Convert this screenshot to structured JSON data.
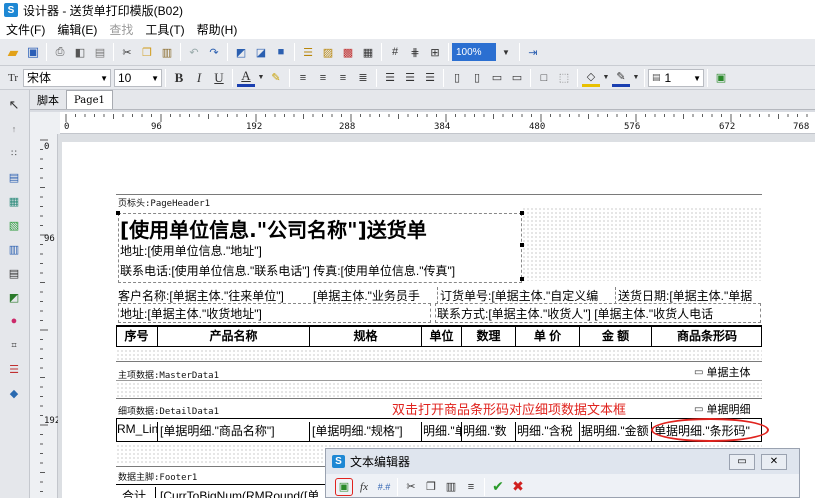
{
  "window": {
    "title": "设计器 - 送货单打印模版(B02)"
  },
  "menu": [
    "文件(F)",
    "编辑(E)",
    "查找",
    "工具(T)",
    "帮助(H)"
  ],
  "toolbar2": {
    "font": "宋体",
    "size": "10",
    "line_width": "1",
    "bold": "B",
    "italic": "I",
    "underline": "U",
    "font_color": "A",
    "zoom": "100%"
  },
  "tabs": [
    "脚本",
    "Page1"
  ],
  "ruler": {
    "marks": [
      "0",
      "96",
      "192",
      "288",
      "384",
      "480",
      "576",
      "672",
      "768"
    ],
    "vmarks": [
      "0",
      "96",
      "192"
    ]
  },
  "report": {
    "page_header_label": "页标头:PageHeader1",
    "title": "[使用单位信息.\"公司名称\"]送货单",
    "address": "地址:[使用单位信息.\"地址\"]",
    "contact": "联系电话:[使用单位信息.\"联系电话\"] 传真:[使用单位信息.\"传真\"]",
    "row1": [
      "客户名称:[单据主体.\"往来单位\"]",
      "[单据主体.\"业务员手",
      "订货单号:[单据主体.\"自定义编",
      "送货日期:[单据主体.\"单据"
    ],
    "row2": [
      "地址:[单据主体.\"收货地址\"]",
      "联系方式:[单据主体.\"收货人\"] [单据主体.\"收货人电话"
    ],
    "columns": [
      "序号",
      "产品名称",
      "规格",
      "单位",
      "数理",
      "单 价",
      "金 额",
      "商品条形码"
    ],
    "master_label": "主项数据:MasterData1",
    "master_source": "单据主体",
    "detail_label": "细项数据:DetailData1",
    "detail_source": "单据明细",
    "detail_cells": [
      "RM_Lin",
      "[单据明细.\"商品名称\"]",
      "[单据明细.\"规格\"]",
      "明细.\"单",
      "明细.\"数",
      "明细.\"含税",
      "据明细.\"金额",
      "单据明细.\"条形码\""
    ],
    "footer_label": "数据主脚:Footer1",
    "footer_cells": [
      "合计",
      "[CurrToBigNum(RMRound([单"
    ],
    "annotation": "双击打开商品条形码对应细项数据文本框"
  },
  "dialog": {
    "title": "文本编辑器"
  },
  "colors": {
    "annotation": "#e0231e",
    "accent": "#1e88d4"
  }
}
